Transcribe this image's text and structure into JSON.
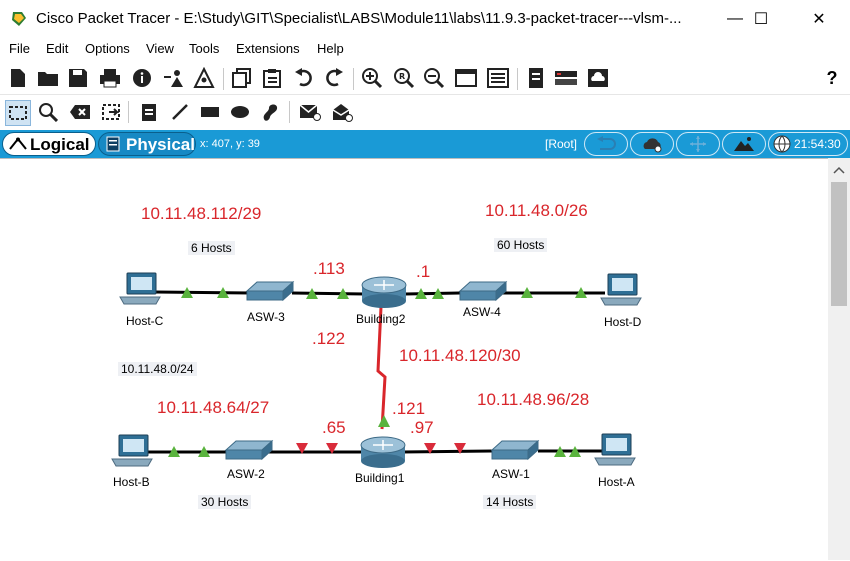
{
  "window": {
    "title": "Cisco Packet Tracer - E:\\Study\\GIT\\Specialist\\LABS\\Module11\\labs\\11.9.3-packet-tracer---vlsm-...",
    "minimize": "—",
    "maximize": "☐",
    "close": "✕"
  },
  "menu": {
    "file": "File",
    "edit": "Edit",
    "options": "Options",
    "view": "View",
    "tools": "Tools",
    "extensions": "Extensions",
    "help": "Help"
  },
  "viewbar": {
    "logical": "Logical",
    "physical": "Physical",
    "coords": "x: 407, y: 39",
    "root": "[Root]",
    "clock": "21:54:30"
  },
  "topology": {
    "subnets": {
      "building2_asw3": "10.11.48.112/29",
      "building2_asw4": "10.11.48.0/26",
      "link_120": "10.11.48.120/30",
      "building1_asw2": "10.11.48.64/27",
      "building1_asw1": "10.11.48.96/28"
    },
    "interfaces": {
      "b2_113": ".113",
      "b2_1": ".1",
      "b2_122": ".122",
      "b1_121": ".121",
      "b1_65": ".65",
      "b1_97": ".97"
    },
    "notes": {
      "hosts_6": "6 Hosts",
      "hosts_60": "60 Hosts",
      "block": "10.11.48.0/24",
      "hosts_30": "30 Hosts",
      "hosts_14": "14 Hosts"
    },
    "devices": {
      "host_c": "Host-C",
      "asw3": "ASW-3",
      "building2": "Building2",
      "asw4": "ASW-4",
      "host_d": "Host-D",
      "host_b": "Host-B",
      "asw2": "ASW-2",
      "building1": "Building1",
      "asw1": "ASW-1",
      "host_a": "Host-A"
    },
    "colors": {
      "link_up": "#59b33d",
      "link_down": "#d92b3a",
      "serial": "#d9262b",
      "label": "#d9262b"
    }
  }
}
